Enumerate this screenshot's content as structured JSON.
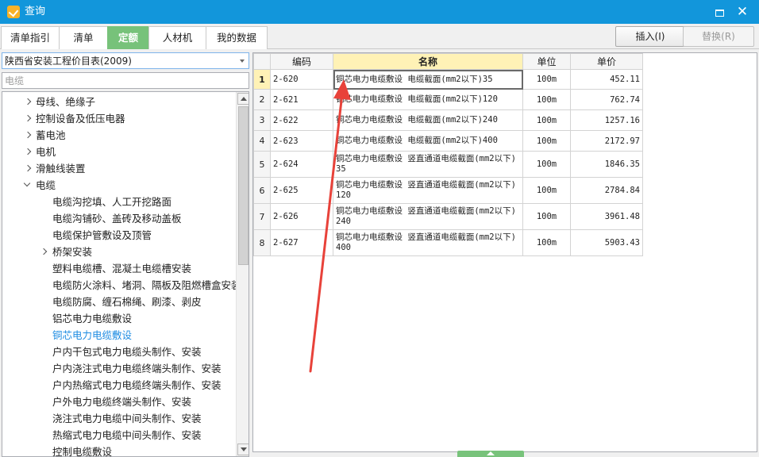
{
  "window": {
    "title": "查询"
  },
  "tabs": [
    {
      "label": "清单指引",
      "active": false
    },
    {
      "label": "清单",
      "active": false
    },
    {
      "label": "定额",
      "active": true
    },
    {
      "label": "人材机",
      "active": false
    },
    {
      "label": "我的数据",
      "active": false
    }
  ],
  "buttons": {
    "insert": "插入(I)",
    "replace": "替换(R)"
  },
  "library": {
    "selected": "陕西省安装工程价目表(2009)"
  },
  "search": {
    "value": "",
    "placeholder": "电缆"
  },
  "tree": [
    {
      "label": "母线、绝缘子",
      "level": 0,
      "toggle": "collapsed"
    },
    {
      "label": "控制设备及低压电器",
      "level": 0,
      "toggle": "collapsed"
    },
    {
      "label": "蓄电池",
      "level": 0,
      "toggle": "collapsed"
    },
    {
      "label": "电机",
      "level": 0,
      "toggle": "collapsed"
    },
    {
      "label": "滑触线装置",
      "level": 0,
      "toggle": "collapsed"
    },
    {
      "label": "电缆",
      "level": 0,
      "toggle": "expanded"
    },
    {
      "label": "电缆沟挖填、人工开挖路面",
      "level": 1,
      "toggle": ""
    },
    {
      "label": "电缆沟铺砂、盖砖及移动盖板",
      "level": 1,
      "toggle": ""
    },
    {
      "label": "电缆保护管敷设及顶管",
      "level": 1,
      "toggle": ""
    },
    {
      "label": "桥架安装",
      "level": 1,
      "toggle": "collapsed"
    },
    {
      "label": "塑料电缆槽、混凝土电缆槽安装",
      "level": 1,
      "toggle": ""
    },
    {
      "label": "电缆防火涂料、堵洞、隔板及阻燃槽盒安装",
      "level": 1,
      "toggle": ""
    },
    {
      "label": "电缆防腐、缠石棉绳、刷漆、剥皮",
      "level": 1,
      "toggle": ""
    },
    {
      "label": "铝芯电力电缆敷设",
      "level": 1,
      "toggle": ""
    },
    {
      "label": "铜芯电力电缆敷设",
      "level": 1,
      "toggle": "",
      "selected": true
    },
    {
      "label": "户内干包式电力电缆头制作、安装",
      "level": 1,
      "toggle": ""
    },
    {
      "label": "户内浇注式电力电缆终端头制作、安装",
      "level": 1,
      "toggle": ""
    },
    {
      "label": "户内热缩式电力电缆终端头制作、安装",
      "level": 1,
      "toggle": ""
    },
    {
      "label": "户外电力电缆终端头制作、安装",
      "level": 1,
      "toggle": ""
    },
    {
      "label": "浇注式电力电缆中间头制作、安装",
      "level": 1,
      "toggle": ""
    },
    {
      "label": "热缩式电力电缆中间头制作、安装",
      "level": 1,
      "toggle": ""
    },
    {
      "label": "控制电缆敷设",
      "level": 1,
      "toggle": ""
    }
  ],
  "grid": {
    "columns": [
      "编码",
      "名称",
      "单位",
      "单价"
    ],
    "rows": [
      {
        "no": "1",
        "code": "2-620",
        "name": "铜芯电力电缆敷设 电缆截面(mm2以下)35",
        "unit": "100m",
        "price": "452.11"
      },
      {
        "no": "2",
        "code": "2-621",
        "name": "铜芯电力电缆敷设 电缆截面(mm2以下)120",
        "unit": "100m",
        "price": "762.74"
      },
      {
        "no": "3",
        "code": "2-622",
        "name": "铜芯电力电缆敷设 电缆截面(mm2以下)240",
        "unit": "100m",
        "price": "1257.16"
      },
      {
        "no": "4",
        "code": "2-623",
        "name": "铜芯电力电缆敷设 电缆截面(mm2以下)400",
        "unit": "100m",
        "price": "2172.97"
      },
      {
        "no": "5",
        "code": "2-624",
        "name": "铜芯电力电缆敷设 竖直通道电缆截面(mm2以下)35",
        "unit": "100m",
        "price": "1846.35"
      },
      {
        "no": "6",
        "code": "2-625",
        "name": "铜芯电力电缆敷设 竖直通道电缆截面(mm2以下)120",
        "unit": "100m",
        "price": "2784.84"
      },
      {
        "no": "7",
        "code": "2-626",
        "name": "铜芯电力电缆敷设 竖直通道电缆截面(mm2以下)240",
        "unit": "100m",
        "price": "3961.48"
      },
      {
        "no": "8",
        "code": "2-627",
        "name": "铜芯电力电缆敷设 竖直通道电缆截面(mm2以下)400",
        "unit": "100m",
        "price": "5903.43"
      }
    ]
  },
  "colors": {
    "titlebar": "#1296db",
    "active_tab": "#77c27a",
    "selected_tree_item": "#1e8ce2",
    "header_highlight": "#fff2b6",
    "annotation_arrow": "#e8423a"
  },
  "icons": {
    "app": "app-logo-icon",
    "maximize": "maximize-icon",
    "close": "close-icon",
    "dropdown": "chevron-down-icon"
  }
}
